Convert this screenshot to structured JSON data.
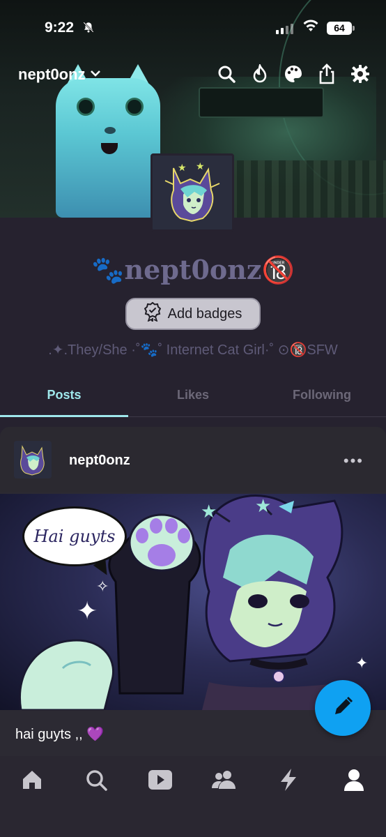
{
  "status_bar": {
    "time": "9:22",
    "battery": "64"
  },
  "top_nav": {
    "blog_name": "nept0onz"
  },
  "profile": {
    "display_name": "nept0onz",
    "add_badges_label": "Add badges",
    "tagline": ".✦.They/She ·˚🐾˚ Internet Cat Girl·˚ ⊙🔞SFW"
  },
  "tabs": [
    {
      "label": "Posts",
      "active": true
    },
    {
      "label": "Likes",
      "active": false
    },
    {
      "label": "Following",
      "active": false
    }
  ],
  "post": {
    "author": "nept0onz",
    "more_label": "•••",
    "bubble_text": "Hai guyts",
    "caption": "hai guyts ,, 💜"
  },
  "bottom_nav": [
    "home-icon",
    "search-icon",
    "video-icon",
    "communities-icon",
    "activity-icon",
    "profile-icon"
  ],
  "colors": {
    "background": "#26222f",
    "accent": "#9fe8ec",
    "fab": "#0fa1f2",
    "display_name": "#6e6a8e"
  }
}
